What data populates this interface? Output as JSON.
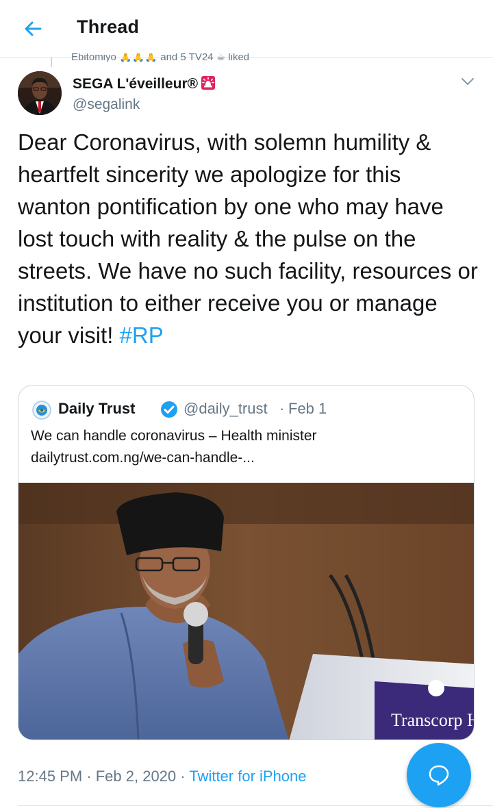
{
  "header": {
    "title": "Thread"
  },
  "previous_tweet": {
    "partial_line": "Ebitomiyo 🙏🙏🙏 and 5 TV24 ☕ liked"
  },
  "tweet": {
    "author_name": "SEGA L'éveilleur®",
    "author_emoji_icon": "siren-icon",
    "handle": "@segalink",
    "text": "Dear Coronavirus, with solemn humility & heartfelt sincerity we apologize for this wanton pontification by one who may have lost touch with reality & the pulse on the streets. We have no such facility, resources or institution to either receive you or manage your visit!",
    "hashtag": "#RP",
    "time": "12:45 PM",
    "sep1": " · ",
    "date": "Feb 2, 2020",
    "sep2": " · ",
    "source": "Twitter for iPhone"
  },
  "quoted_tweet": {
    "name": "Daily Trust",
    "verified_icon": "verified-badge-icon",
    "handle": "@daily_trust",
    "dot": "·",
    "date": "Feb 1",
    "headline": "We can handle coronavirus – Health minister",
    "link": "dailytrust.com.ng/we-can-handle-...",
    "image_sign_text": "Transcorp Hi"
  },
  "colors": {
    "accent": "#1da1f2",
    "text": "#14171a",
    "secondary": "#657786",
    "border": "#ccd6dd"
  },
  "fab": {
    "icon": "compose-reply-icon"
  }
}
